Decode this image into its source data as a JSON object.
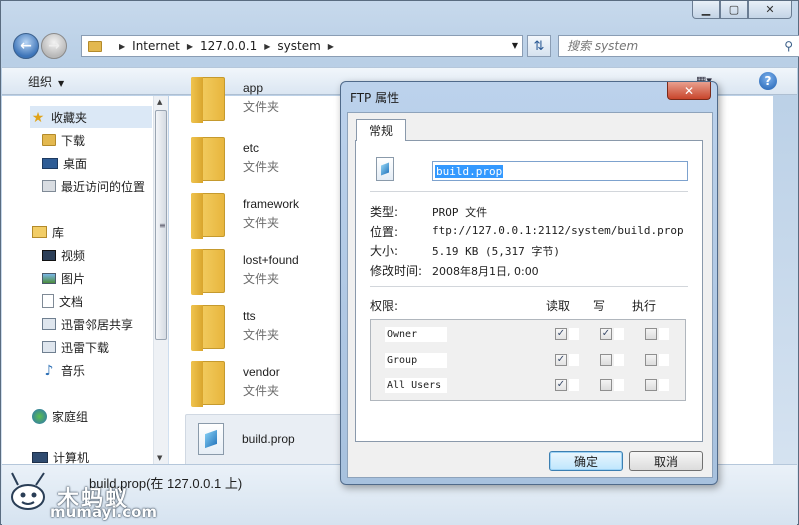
{
  "window": {
    "caption_min": "▁",
    "caption_max": "▢",
    "caption_close": "✕"
  },
  "address": {
    "crumbs": [
      "Internet",
      "127.0.0.1",
      "system"
    ],
    "search_placeholder": "搜索 system"
  },
  "toolbar": {
    "organize_label": "组织"
  },
  "nav": {
    "favorites": "收藏夹",
    "download": "下载",
    "desktop": "桌面",
    "recent": "最近访问的位置",
    "libraries": "库",
    "videos": "视频",
    "pictures": "图片",
    "documents": "文档",
    "xunlei_share": "迅雷邻居共享",
    "xunlei_download": "迅雷下载",
    "music": "音乐",
    "homegroup": "家庭组",
    "computer": "计算机"
  },
  "files": [
    {
      "name": "app",
      "type": "文件夹"
    },
    {
      "name": "etc",
      "type": "文件夹"
    },
    {
      "name": "framework",
      "type": "文件夹"
    },
    {
      "name": "lost+found",
      "type": "文件夹"
    },
    {
      "name": "tts",
      "type": "文件夹"
    },
    {
      "name": "vendor",
      "type": "文件夹"
    },
    {
      "name": "build.prop",
      "type": ""
    }
  ],
  "status": {
    "text": "build.prop(在 127.0.0.1 上)"
  },
  "watermark": {
    "cn": "木蚂蚁",
    "url": "mumayi.com"
  },
  "dialog": {
    "title": "FTP 属性",
    "tab": "常规",
    "filename": "build.prop",
    "type_label": "类型:",
    "type_value": "PROP 文件",
    "location_label": "位置:",
    "location_value": "ftp://127.0.0.1:2112/system/build.prop",
    "size_label": "大小:",
    "size_value": "5.19 KB (5,317 字节)",
    "modified_label": "修改时间:",
    "modified_value": "2008年8月1日, 0:00",
    "perm_label": "权限:",
    "perm_read": "读取",
    "perm_write": "写",
    "perm_exec": "执行",
    "permissions": [
      {
        "who": "Owner",
        "read": true,
        "write": true,
        "exec": false
      },
      {
        "who": "Group",
        "read": true,
        "write": false,
        "exec": false
      },
      {
        "who": "All Users",
        "read": true,
        "write": false,
        "exec": false
      }
    ],
    "ok": "确定",
    "cancel": "取消"
  }
}
